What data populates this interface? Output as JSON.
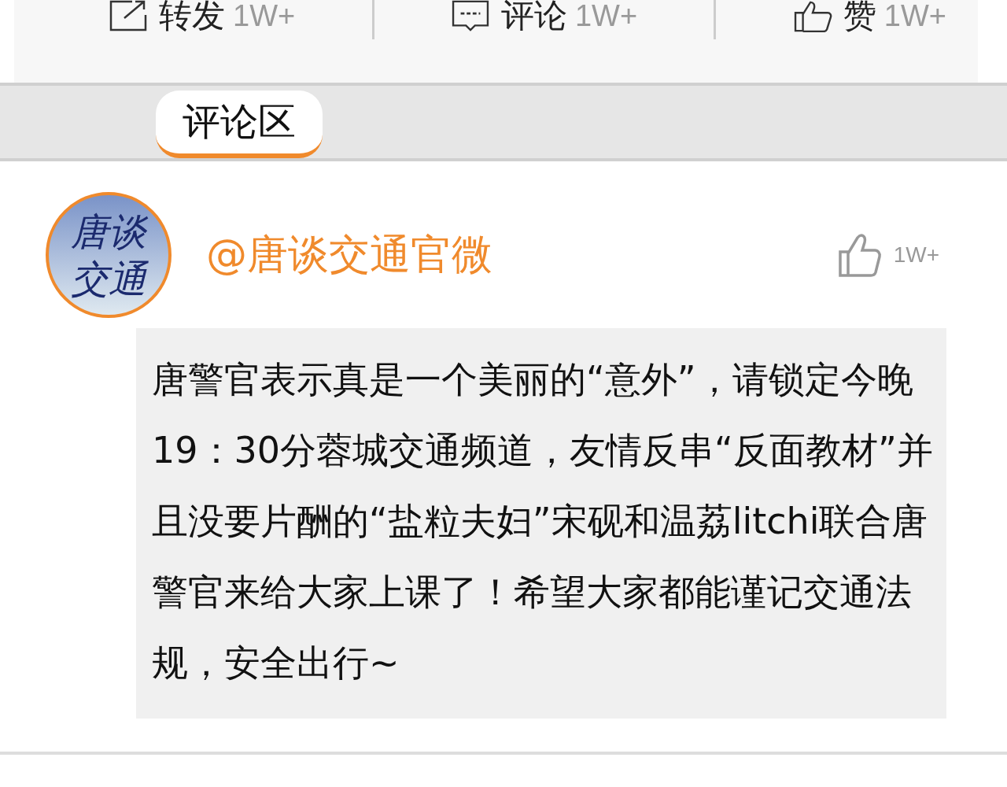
{
  "actions": [
    {
      "kind": "share",
      "label": "转发",
      "count": "1W+"
    },
    {
      "kind": "comment",
      "label": "评论",
      "count": "1W+"
    },
    {
      "kind": "like",
      "label": "赞",
      "count": "1W+"
    }
  ],
  "tabs": [
    {
      "label": "评论区",
      "selected": true
    }
  ],
  "comment": {
    "avatar_text": "唐谈交通",
    "author": "@唐谈交通官微",
    "likes": "1W+",
    "text": "唐警官表示真是一个美丽的“意外”，请锁定今晚19：30分蓉城交通频道，友情反串“反面教材”并且没要片酬的“盐粒夫妇”宋砚和温荔litchi联合唐警官来给大家上课了！希望大家都能谨记交通法规，安全出行~"
  }
}
